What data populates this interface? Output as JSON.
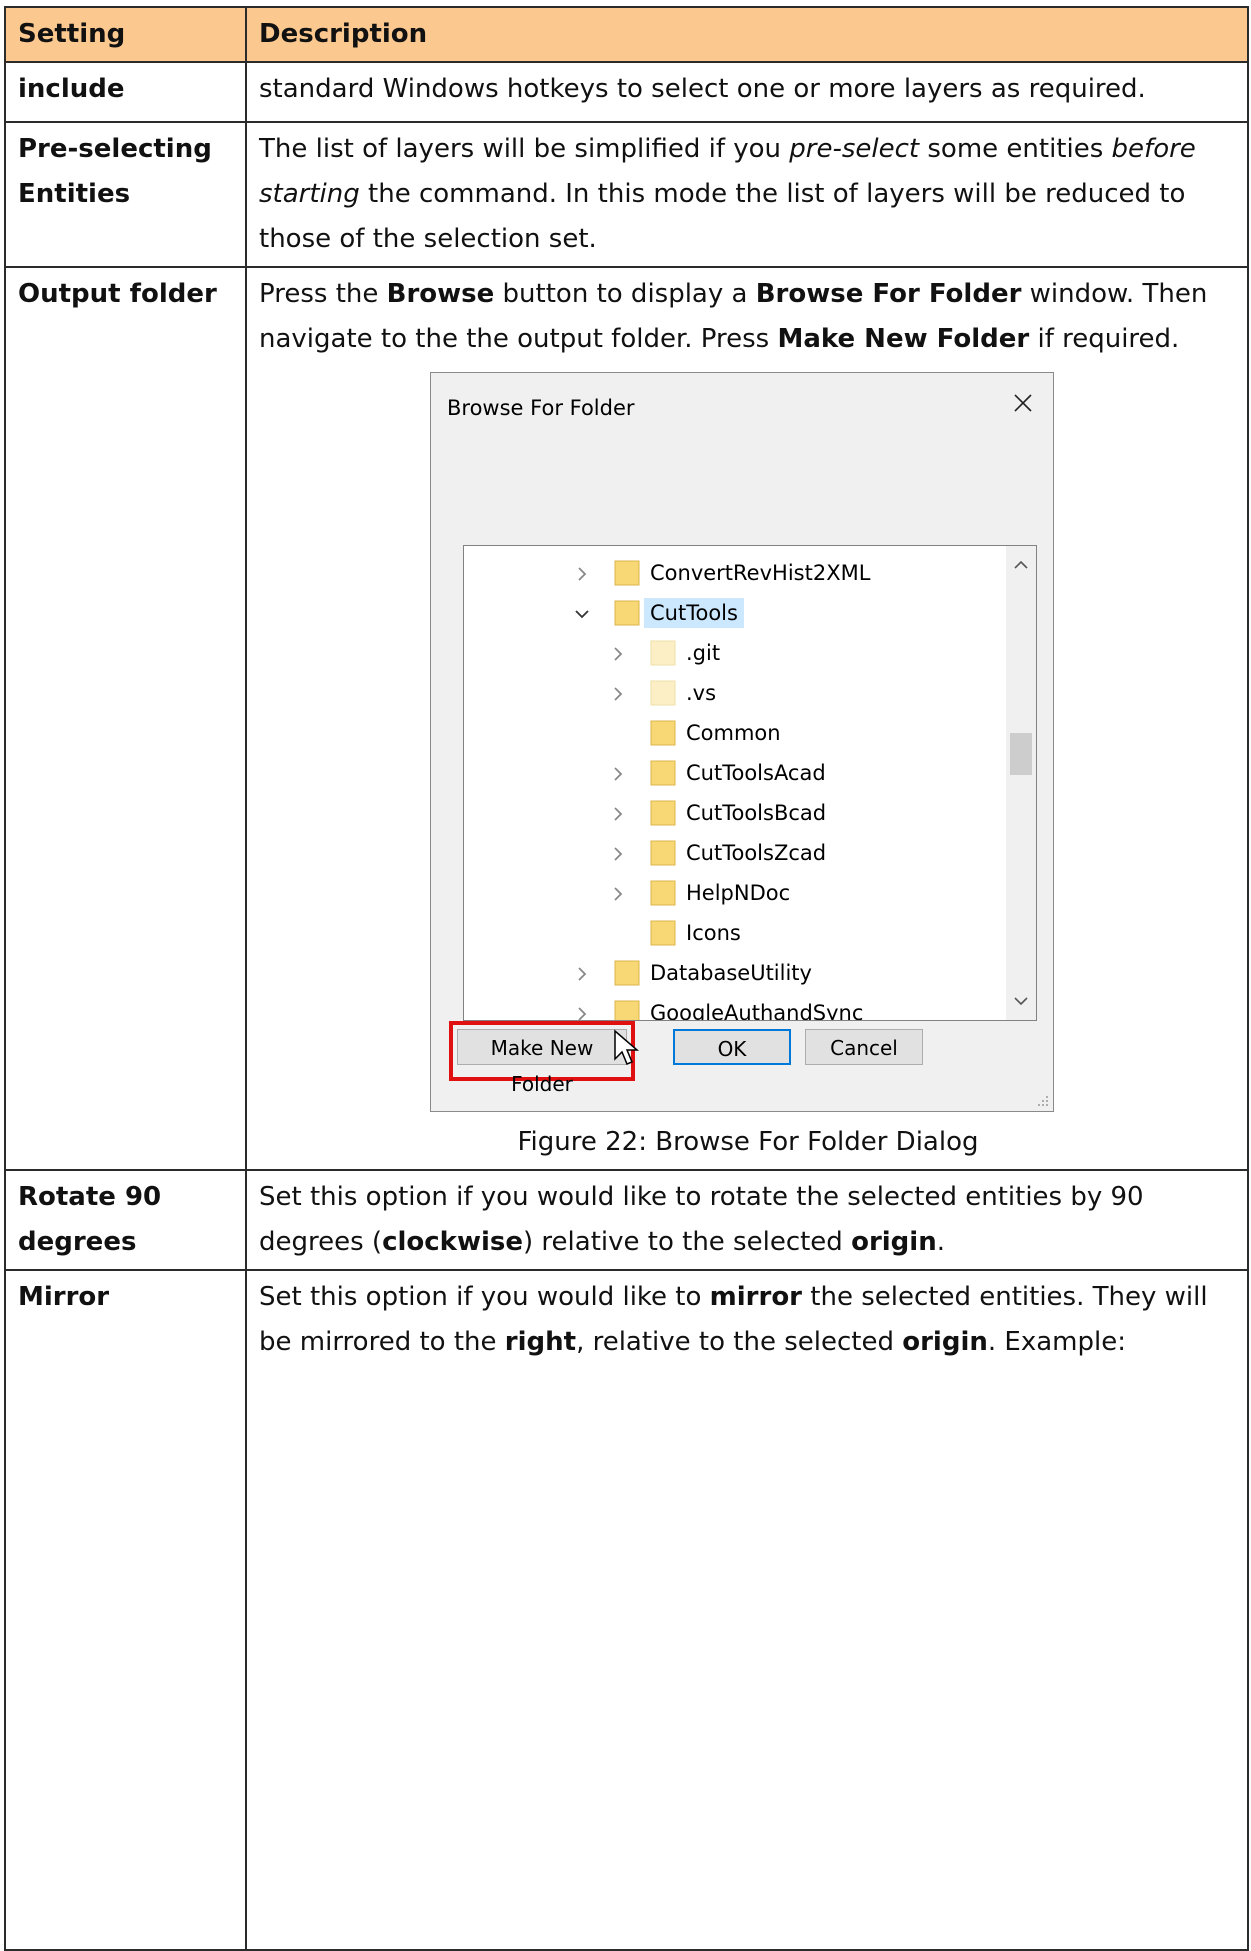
{
  "table": {
    "headers": {
      "setting": "Setting",
      "description": "Description"
    },
    "rows": {
      "include": {
        "setting": "include",
        "text": "standard Windows hotkeys to select one or more layers as required."
      },
      "preselect": {
        "setting": "Pre-selecting Entities",
        "t1": "The list of layers will be simplified if you ",
        "t2": "pre-select",
        "t3": " some entities ",
        "t4": "before starting",
        "t5": " the command. In this mode the list of layers will be reduced to those of the selection set."
      },
      "output": {
        "setting": "Output folder",
        "t1": "Press the ",
        "t2": "Browse",
        "t3": " button to display a ",
        "t4": "Browse For Folder",
        "t5": " window. Then navigate to the the output folder. Press ",
        "t6": "Make New Folder",
        "t7": " if required.",
        "caption": "Figure 22: Browse For Folder Dialog"
      },
      "rotate": {
        "setting": "Rotate 90 degrees",
        "t1": "Set this option if you would like to rotate the selected entities by 90 degrees (",
        "t2": "clockwise",
        "t3": ") relative to the selected ",
        "t4": "origin",
        "t5": "."
      },
      "mirror": {
        "setting": "Mirror",
        "t1": "Set this option if you would like to ",
        "t2": "mirror",
        "t3": " the selected entities. They will be mirrored to the ",
        "t4": "right",
        "t5": ", relative to the selected ",
        "t6": "origin",
        "t7": ". Example:"
      }
    }
  },
  "dialog": {
    "title": "Browse For Folder",
    "close_icon": "close-icon",
    "tree": [
      {
        "label": "ConvertRevHist2XML",
        "expand": "collapsed",
        "folder": "normal"
      },
      {
        "label": "CutTools",
        "expand": "expanded",
        "folder": "normal",
        "selected": true
      },
      {
        "label": ".git",
        "expand": "collapsed",
        "folder": "faded"
      },
      {
        "label": ".vs",
        "expand": "collapsed",
        "folder": "faded"
      },
      {
        "label": "Common",
        "expand": "none",
        "folder": "normal"
      },
      {
        "label": "CutToolsAcad",
        "expand": "collapsed",
        "folder": "normal"
      },
      {
        "label": "CutToolsBcad",
        "expand": "collapsed",
        "folder": "normal"
      },
      {
        "label": "CutToolsZcad",
        "expand": "collapsed",
        "folder": "normal"
      },
      {
        "label": "HelpNDoc",
        "expand": "collapsed",
        "folder": "normal"
      },
      {
        "label": "Icons",
        "expand": "none",
        "folder": "normal"
      },
      {
        "label": "DatabaseUtility",
        "expand": "collapsed",
        "folder": "normal"
      },
      {
        "label": "GoogleAuthandSync",
        "expand": "collapsed",
        "folder": "normal"
      }
    ],
    "buttons": {
      "make_new_folder": "Make New Folder",
      "ok": "OK",
      "cancel": "Cancel"
    },
    "colors": {
      "highlight": "#e01010",
      "selection": "#cce8ff",
      "folder": "#f8d775",
      "primary_border": "#0078d7"
    }
  }
}
